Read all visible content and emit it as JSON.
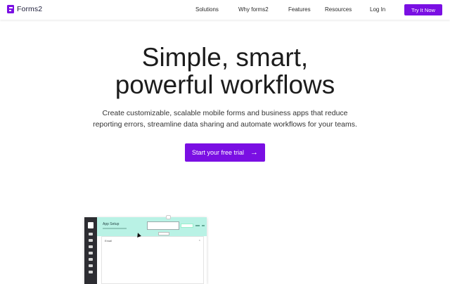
{
  "brand": {
    "name": "Forms2",
    "accent": "#7a0fe3"
  },
  "nav": {
    "links": [
      "Solutions",
      "Why forms2",
      "Features",
      "Resources",
      "Log In"
    ],
    "cta": "Try It Now"
  },
  "hero": {
    "title_line1": "Simple, smart,",
    "title_line2": "powerful workflows",
    "subtitle_line1": "Create customizable, scalable mobile forms and business apps that reduce",
    "subtitle_line2": "reporting errors, streamline data sharing and automate workflows for your teams.",
    "cta": "Start your free trial",
    "cta_icon": "arrow-right-icon"
  },
  "mockup": {
    "header_title": "App Setup",
    "row_label": "Email",
    "row_close": "×",
    "header_color": "#b9f2e5",
    "sidebar_color": "#2d2d32"
  }
}
